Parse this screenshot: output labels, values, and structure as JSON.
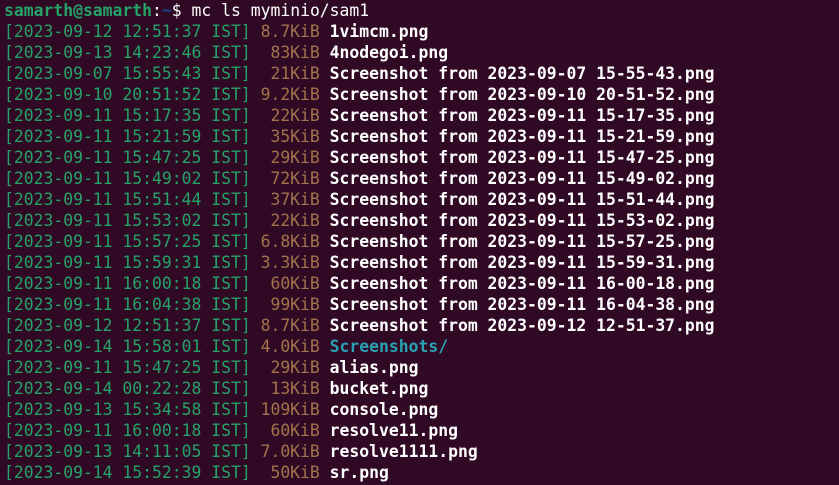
{
  "prompt": {
    "user_host": "samarth@samarth",
    "separator": ":",
    "path": "~",
    "symbol": "$",
    "command": " mc ls myminio/sam1"
  },
  "entries": [
    {
      "timestamp": "[2023-09-12 12:51:37 IST]",
      "size": "8.7KiB",
      "name": "1vimcm.png",
      "type": "file"
    },
    {
      "timestamp": "[2023-09-13 14:23:46 IST]",
      "size": " 83KiB",
      "name": "4nodegoi.png",
      "type": "file"
    },
    {
      "timestamp": "[2023-09-07 15:55:43 IST]",
      "size": " 21KiB",
      "name": "Screenshot from 2023-09-07 15-55-43.png",
      "type": "file"
    },
    {
      "timestamp": "[2023-09-10 20:51:52 IST]",
      "size": "9.2KiB",
      "name": "Screenshot from 2023-09-10 20-51-52.png",
      "type": "file"
    },
    {
      "timestamp": "[2023-09-11 15:17:35 IST]",
      "size": " 22KiB",
      "name": "Screenshot from 2023-09-11 15-17-35.png",
      "type": "file"
    },
    {
      "timestamp": "[2023-09-11 15:21:59 IST]",
      "size": " 35KiB",
      "name": "Screenshot from 2023-09-11 15-21-59.png",
      "type": "file"
    },
    {
      "timestamp": "[2023-09-11 15:47:25 IST]",
      "size": " 29KiB",
      "name": "Screenshot from 2023-09-11 15-47-25.png",
      "type": "file"
    },
    {
      "timestamp": "[2023-09-11 15:49:02 IST]",
      "size": " 72KiB",
      "name": "Screenshot from 2023-09-11 15-49-02.png",
      "type": "file"
    },
    {
      "timestamp": "[2023-09-11 15:51:44 IST]",
      "size": " 37KiB",
      "name": "Screenshot from 2023-09-11 15-51-44.png",
      "type": "file"
    },
    {
      "timestamp": "[2023-09-11 15:53:02 IST]",
      "size": " 22KiB",
      "name": "Screenshot from 2023-09-11 15-53-02.png",
      "type": "file"
    },
    {
      "timestamp": "[2023-09-11 15:57:25 IST]",
      "size": "6.8KiB",
      "name": "Screenshot from 2023-09-11 15-57-25.png",
      "type": "file"
    },
    {
      "timestamp": "[2023-09-11 15:59:31 IST]",
      "size": "3.3KiB",
      "name": "Screenshot from 2023-09-11 15-59-31.png",
      "type": "file"
    },
    {
      "timestamp": "[2023-09-11 16:00:18 IST]",
      "size": " 60KiB",
      "name": "Screenshot from 2023-09-11 16-00-18.png",
      "type": "file"
    },
    {
      "timestamp": "[2023-09-11 16:04:38 IST]",
      "size": " 99KiB",
      "name": "Screenshot from 2023-09-11 16-04-38.png",
      "type": "file"
    },
    {
      "timestamp": "[2023-09-12 12:51:37 IST]",
      "size": "8.7KiB",
      "name": "Screenshot from 2023-09-12 12-51-37.png",
      "type": "file"
    },
    {
      "timestamp": "[2023-09-14 15:58:01 IST]",
      "size": "4.0KiB",
      "name": "Screenshots/",
      "type": "dir"
    },
    {
      "timestamp": "[2023-09-11 15:47:25 IST]",
      "size": " 29KiB",
      "name": "alias.png",
      "type": "file"
    },
    {
      "timestamp": "[2023-09-14 00:22:28 IST]",
      "size": " 13KiB",
      "name": "bucket.png",
      "type": "file"
    },
    {
      "timestamp": "[2023-09-13 15:34:58 IST]",
      "size": "109KiB",
      "name": "console.png",
      "type": "file"
    },
    {
      "timestamp": "[2023-09-11 16:00:18 IST]",
      "size": " 60KiB",
      "name": "resolve11.png",
      "type": "file"
    },
    {
      "timestamp": "[2023-09-13 14:11:05 IST]",
      "size": "7.0KiB",
      "name": "resolve1111.png",
      "type": "file"
    },
    {
      "timestamp": "[2023-09-14 15:52:39 IST]",
      "size": " 50KiB",
      "name": "sr.png",
      "type": "file"
    }
  ],
  "colors": {
    "background": "#300a24",
    "prompt_user": "#26a269",
    "prompt_path": "#12488b",
    "timestamp": "#26a269",
    "size": "#a2734c",
    "file": "#ffffff",
    "directory": "#2aa1b3"
  }
}
